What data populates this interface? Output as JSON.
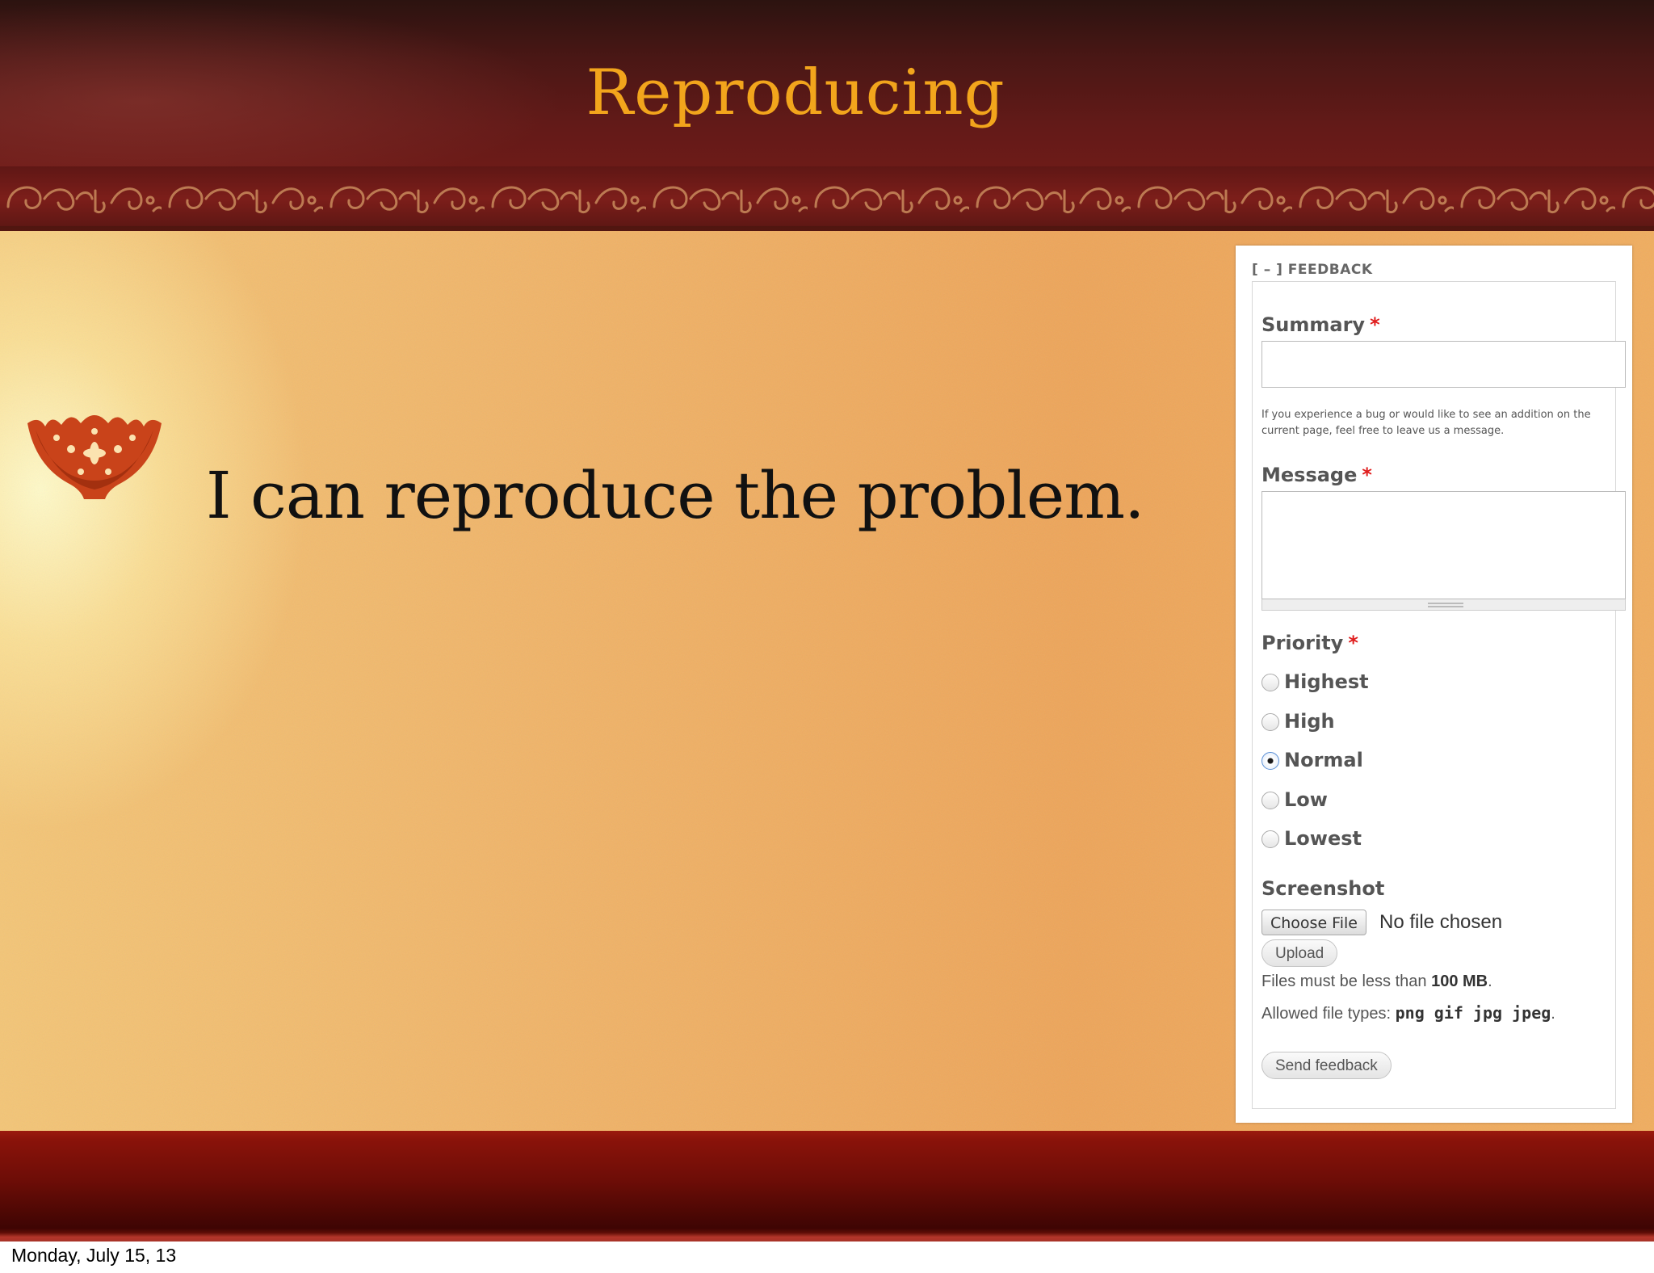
{
  "slide": {
    "title": "Reproducing",
    "bullet": "I can reproduce the problem.",
    "footer_date": "Monday, July 15, 13"
  },
  "feedback": {
    "legend": "[ – ] FEEDBACK",
    "summary_label": "Summary",
    "summary_value": "",
    "summary_help": "If you experience a bug or would like to see an addition on the current page, feel free to leave us a message.",
    "message_label": "Message",
    "message_value": "",
    "required_mark": "*",
    "priority_label": "Priority",
    "priority_options": [
      "Highest",
      "High",
      "Normal",
      "Low",
      "Lowest"
    ],
    "priority_selected": "Normal",
    "screenshot_label": "Screenshot",
    "choose_file_label": "Choose File",
    "no_file_text": "No file chosen",
    "upload_label": "Upload",
    "size_note_prefix": "Files must be less than",
    "size_limit": "100 MB",
    "types_note_prefix": "Allowed file types:",
    "file_types": "png gif jpg jpeg",
    "send_label": "Send feedback"
  },
  "colors": {
    "title": "#f2a51c",
    "required": "#e01d1d",
    "header_bg": "#4a1715",
    "content_bg": "#f0b56a",
    "footer_bg": "#6d0d07"
  }
}
